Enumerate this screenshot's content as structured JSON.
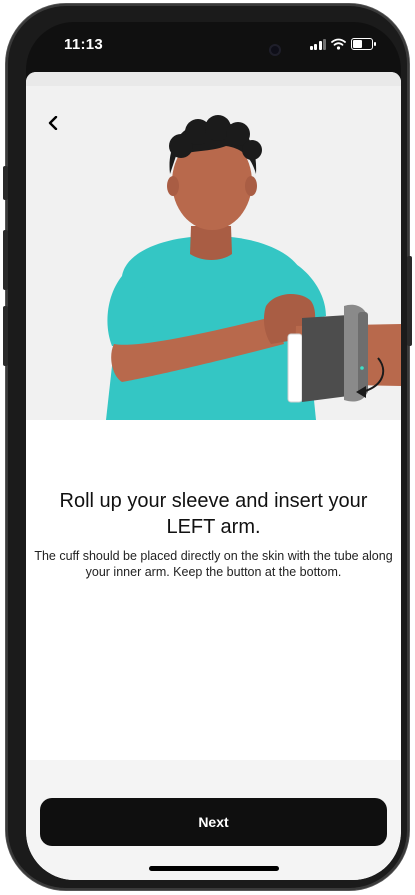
{
  "status_bar": {
    "time": "11:13",
    "icons": [
      "signal-icon",
      "wifi-icon",
      "battery-icon"
    ]
  },
  "navigation": {
    "back_icon": "chevron-left-icon"
  },
  "illustration": {
    "name": "person-inserting-arm-into-cuff-illustration",
    "colors": {
      "background": "#f1f1f1",
      "shirt": "#34c6c4",
      "skin": "#b8694c",
      "hair": "#1b1b1b",
      "cuff": "#555555"
    }
  },
  "instruction": {
    "title": "Roll up your sleeve and insert your LEFT arm.",
    "body": "The cuff should be placed directly on the skin with the tube along your inner arm. Keep the button at the bottom."
  },
  "actions": {
    "next_label": "Next"
  },
  "colors": {
    "primary_button": "#0f0f0f",
    "button_text": "#ffffff"
  }
}
